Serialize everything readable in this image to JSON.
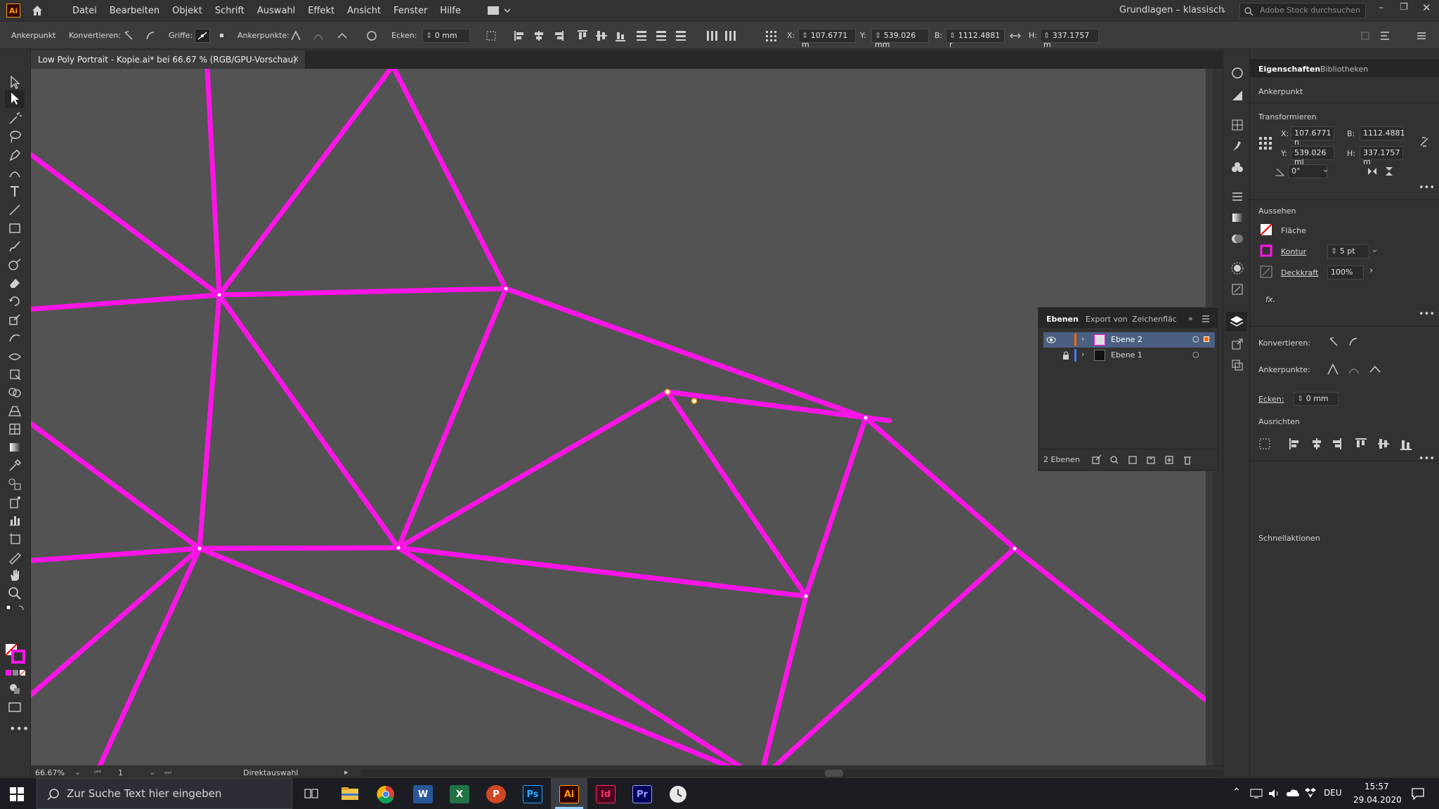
{
  "menubar": {
    "logo": "Ai",
    "items": [
      "Datei",
      "Bearbeiten",
      "Objekt",
      "Schrift",
      "Auswahl",
      "Effekt",
      "Ansicht",
      "Fenster",
      "Hilfe"
    ],
    "workspace": "Grundlagen – klassisch",
    "stock_search_placeholder": "Adobe Stock durchsuchen"
  },
  "controlbar": {
    "mode_label": "Ankerpunkt",
    "convert_label": "Konvertieren:",
    "handles_label": "Griffe:",
    "anchors_label": "Ankerpunkte:",
    "corners_label": "Ecken:",
    "corners_value": "0 mm",
    "x_label": "X:",
    "x_value": "107.6771 m",
    "y_label": "Y:",
    "y_value": "539.026 mm",
    "b_label": "B:",
    "b_value": "1112.4881 r",
    "h_label": "H:",
    "h_value": "337.1757 m"
  },
  "document": {
    "tab_title": "Low Poly Portrait - Kopie.ai* bei 66.67 % (RGB/GPU-Vorschau)",
    "close": "×"
  },
  "statusbar": {
    "zoom": "66.67%",
    "artboard": "1",
    "tool": "Direktauswahl"
  },
  "properties": {
    "tab_properties": "Eigenschaften",
    "tab_libraries": "Bibliotheken",
    "selection_type": "Ankerpunkt",
    "transform_heading": "Transformieren",
    "x_label": "X:",
    "x_value": "107.6771 n",
    "y_label": "Y:",
    "y_value": "539.026 mi",
    "b_label": "B:",
    "b_value": "1112.4881",
    "h_label": "H:",
    "h_value": "337.1757 m",
    "angle_value": "0°",
    "appearance_heading": "Aussehen",
    "fill_label": "Fläche",
    "stroke_label": "Kontur",
    "stroke_value": "5 pt",
    "opacity_label": "Deckkraft",
    "opacity_value": "100%",
    "fx_label": "fx.",
    "convert_label": "Konvertieren:",
    "anchors_label": "Ankerpunkte:",
    "corners_label": "Ecken:",
    "corners_value": "0 mm",
    "align_heading": "Ausrichten",
    "quick_actions_heading": "Schnellaktionen"
  },
  "layers": {
    "tabs": [
      "Ebenen",
      "Export von",
      "Zeichenfläc"
    ],
    "items": [
      {
        "name": "Ebene 2",
        "color": "#ff6a00"
      },
      {
        "name": "Ebene 1",
        "color": "#4a7bff"
      }
    ],
    "count_label": "2 Ebenen"
  },
  "taskbar": {
    "search_placeholder": "Zur Suche Text hier eingeben",
    "apps": [
      {
        "name": "word",
        "label": "W",
        "color": "#2b579a"
      },
      {
        "name": "excel",
        "label": "X",
        "color": "#217346"
      },
      {
        "name": "powerpoint",
        "label": "P",
        "color": "#d24726"
      },
      {
        "name": "photoshop",
        "label": "Ps",
        "color": "#001e36"
      },
      {
        "name": "illustrator",
        "label": "Ai",
        "color": "#330000"
      },
      {
        "name": "indesign",
        "label": "Id",
        "color": "#49021f"
      },
      {
        "name": "premiere",
        "label": "Pr",
        "color": "#00005b"
      }
    ],
    "language": "DEU",
    "time": "15:57",
    "date": "29.04.2020"
  },
  "colors": {
    "stroke": "#ff14e8",
    "canvas": "#535353",
    "panel": "#323232"
  }
}
